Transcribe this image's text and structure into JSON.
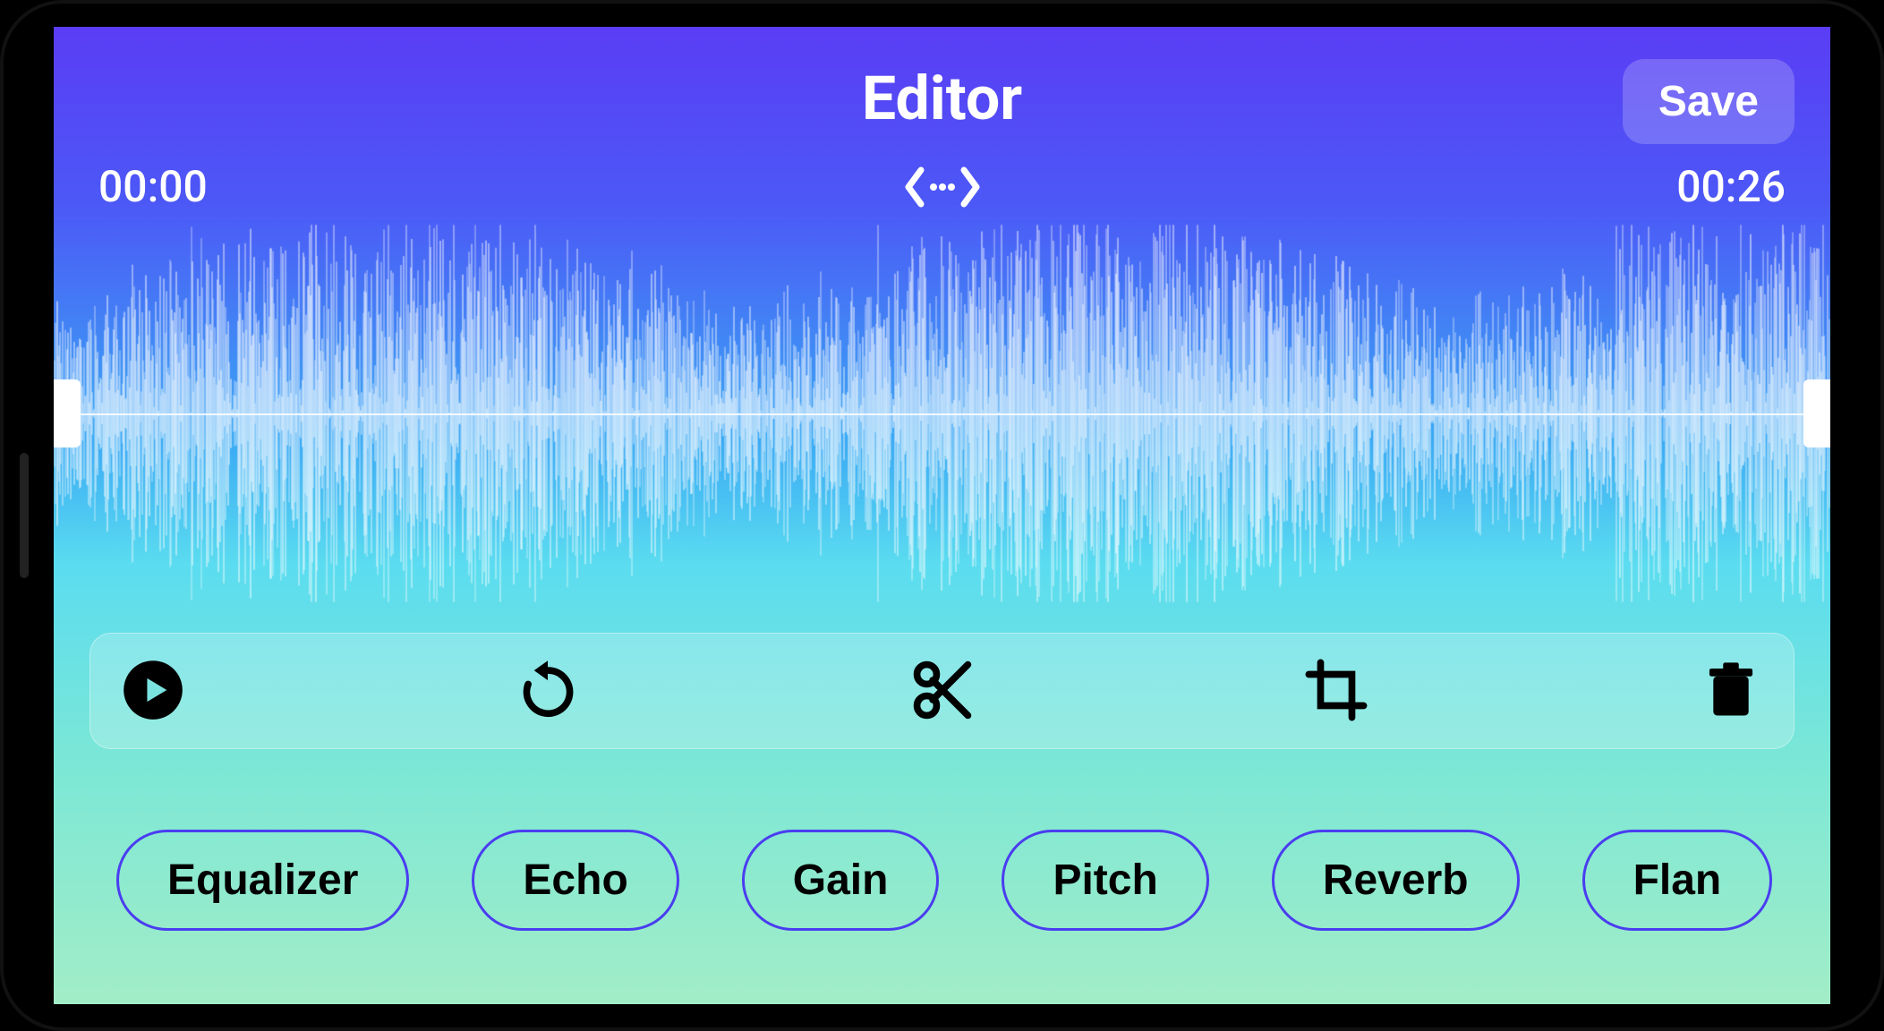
{
  "header": {
    "title": "Editor",
    "save_label": "Save"
  },
  "time": {
    "start": "00:00",
    "end": "00:26"
  },
  "icons": {
    "expand": "expand-horizontal-icon",
    "play": "play-icon",
    "undo": "undo-icon",
    "cut": "cut-icon",
    "crop": "crop-icon",
    "delete": "trash-icon"
  },
  "effects": [
    {
      "label": "Equalizer"
    },
    {
      "label": "Echo"
    },
    {
      "label": "Gain"
    },
    {
      "label": "Pitch"
    },
    {
      "label": "Reverb"
    },
    {
      "label": "Flan"
    }
  ]
}
